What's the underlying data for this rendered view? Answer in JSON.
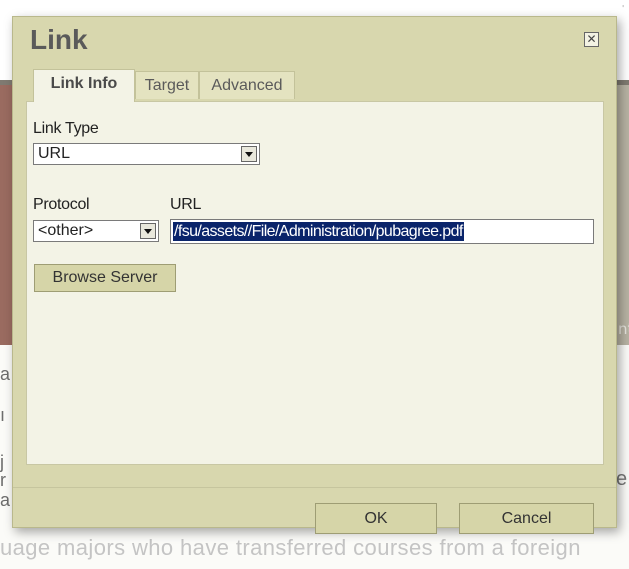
{
  "background": {
    "right_edge_text": "nt",
    "right_letter": "e",
    "left_letters": [
      "a",
      "ı",
      "j",
      "r",
      "a"
    ],
    "bottom_text": "uage majors who have transferred courses from a foreign"
  },
  "dialog": {
    "title": "Link",
    "close_icon": "close-icon",
    "tabs": [
      {
        "label": "Link Info",
        "active": true
      },
      {
        "label": "Target",
        "active": false
      },
      {
        "label": "Advanced",
        "active": false
      }
    ],
    "link_type": {
      "label": "Link Type",
      "value": "URL"
    },
    "protocol": {
      "label": "Protocol",
      "value": "<other>"
    },
    "url": {
      "label": "URL",
      "value": "/fsu/assets//File/Administration/pubagree.pdf"
    },
    "browse_button": "Browse Server",
    "ok_button": "OK",
    "cancel_button": "Cancel"
  },
  "colors": {
    "dialog_bg": "#d8d7ae",
    "panel_bg": "#f3f3e6",
    "selection": "#0a246a",
    "button_bg": "#d6d5a8"
  }
}
